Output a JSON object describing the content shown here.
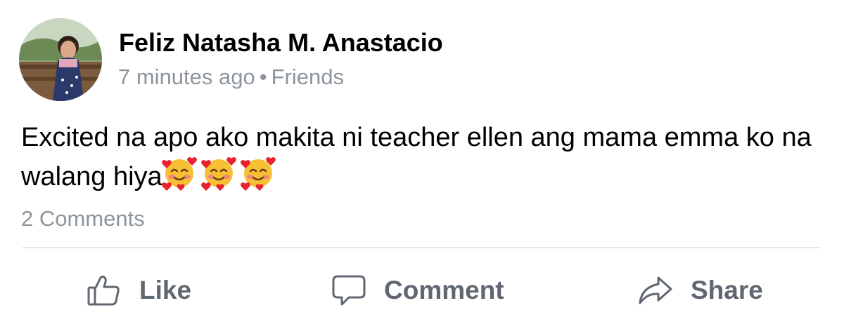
{
  "post": {
    "author": "Feliz Natasha M. Anastacio",
    "timestamp": "7 minutes ago",
    "separator": "•",
    "audience": "Friends",
    "text": "Excited na apo ako makita ni teacher ellen ang mama emma ko na walang hiya",
    "emojis": [
      "smiling-face-with-hearts-emoji",
      "smiling-face-with-hearts-emoji",
      "smiling-face-with-hearts-emoji"
    ],
    "comments_label": "2 Comments"
  },
  "actions": {
    "like_label": "Like",
    "like_icon": "thumbs-up-icon",
    "comment_label": "Comment",
    "comment_icon": "speech-bubble-icon",
    "share_label": "Share",
    "share_icon": "share-arrow-icon"
  },
  "colors": {
    "author_text": "#000000",
    "meta_text": "#8d949e",
    "action_text": "#606770",
    "divider": "#e4e6eb"
  }
}
